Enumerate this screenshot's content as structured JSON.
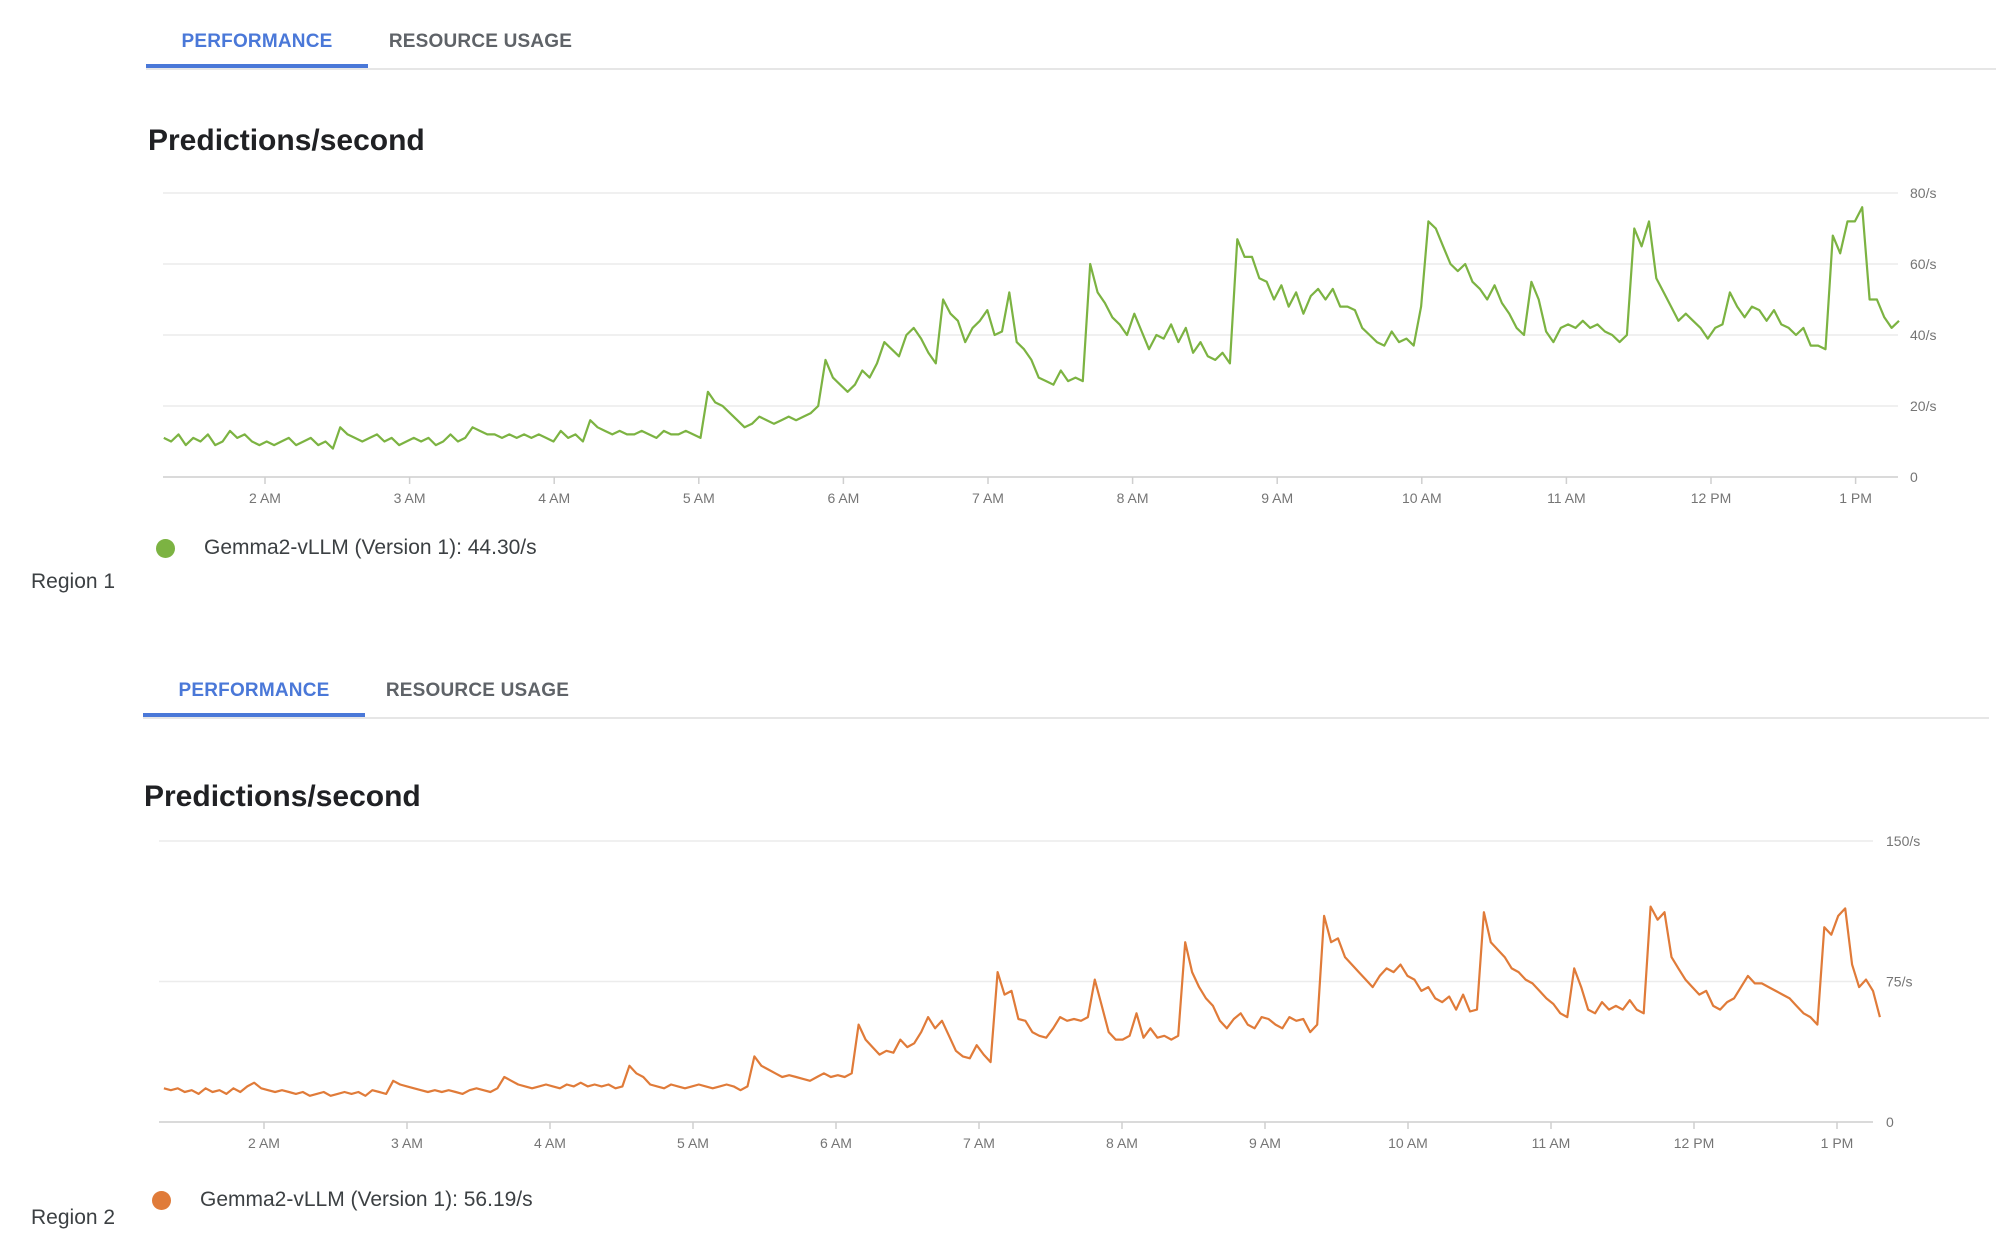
{
  "panels": [
    {
      "region_label": "Region 1",
      "tabs": [
        {
          "label": "PERFORMANCE",
          "active": true
        },
        {
          "label": "RESOURCE USAGE",
          "active": false
        }
      ],
      "title": "Predictions/second",
      "legend": {
        "text": "Gemma2-vLLM (Version 1): 44.30/s",
        "color": "#7cb342"
      }
    },
    {
      "region_label": "Region 2",
      "tabs": [
        {
          "label": "PERFORMANCE",
          "active": true
        },
        {
          "label": "RESOURCE USAGE",
          "active": false
        }
      ],
      "title": "Predictions/second",
      "legend": {
        "text": "Gemma2-vLLM (Version 1): 56.19/s",
        "color": "#e07b39"
      }
    }
  ],
  "chart_data": [
    {
      "type": "line",
      "title": "Predictions/second",
      "region": "Region 1",
      "xlabel": "",
      "ylabel": "",
      "x_ticks": [
        "2 AM",
        "3 AM",
        "4 AM",
        "5 AM",
        "6 AM",
        "7 AM",
        "8 AM",
        "9 AM",
        "10 AM",
        "11 AM",
        "12 PM",
        "1 PM"
      ],
      "y_ticks": [
        "0",
        "20/s",
        "40/s",
        "60/s",
        "80/s"
      ],
      "y_tick_values": [
        0,
        20,
        40,
        60,
        80
      ],
      "ylim": [
        0,
        80
      ],
      "x_start_hour": 1.3,
      "x_end_hour": 13.3,
      "grid": true,
      "legend_position": "bottom-left",
      "series": [
        {
          "name": "Gemma2-vLLM (Version 1)",
          "color": "#7cb342",
          "values": [
            11,
            10,
            12,
            9,
            11,
            10,
            12,
            9,
            10,
            13,
            11,
            12,
            10,
            9,
            10,
            9,
            10,
            11,
            9,
            10,
            11,
            9,
            10,
            8,
            14,
            12,
            11,
            10,
            11,
            12,
            10,
            11,
            9,
            10,
            11,
            10,
            11,
            9,
            10,
            12,
            10,
            11,
            14,
            13,
            12,
            12,
            11,
            12,
            11,
            12,
            11,
            12,
            11,
            10,
            13,
            11,
            12,
            10,
            16,
            14,
            13,
            12,
            13,
            12,
            12,
            13,
            12,
            11,
            13,
            12,
            12,
            13,
            12,
            11,
            24,
            21,
            20,
            18,
            16,
            14,
            15,
            17,
            16,
            15,
            16,
            17,
            16,
            17,
            18,
            20,
            33,
            28,
            26,
            24,
            26,
            30,
            28,
            32,
            38,
            36,
            34,
            40,
            42,
            39,
            35,
            32,
            50,
            46,
            44,
            38,
            42,
            44,
            47,
            40,
            41,
            52,
            38,
            36,
            33,
            28,
            27,
            26,
            30,
            27,
            28,
            27,
            60,
            52,
            49,
            45,
            43,
            40,
            46,
            41,
            36,
            40,
            39,
            43,
            38,
            42,
            35,
            38,
            34,
            33,
            35,
            32,
            67,
            62,
            62,
            56,
            55,
            50,
            54,
            48,
            52,
            46,
            51,
            53,
            50,
            53,
            48,
            48,
            47,
            42,
            40,
            38,
            37,
            41,
            38,
            39,
            37,
            48,
            72,
            70,
            65,
            60,
            58,
            60,
            55,
            53,
            50,
            54,
            49,
            46,
            42,
            40,
            55,
            50,
            41,
            38,
            42,
            43,
            42,
            44,
            42,
            43,
            41,
            40,
            38,
            40,
            70,
            65,
            72,
            56,
            52,
            48,
            44,
            46,
            44,
            42,
            39,
            42,
            43,
            52,
            48,
            45,
            48,
            47,
            44,
            47,
            43,
            42,
            40,
            42,
            37,
            37,
            36,
            68,
            63,
            72,
            72,
            76,
            50,
            50,
            45,
            42,
            44
          ]
        }
      ]
    },
    {
      "type": "line",
      "title": "Predictions/second",
      "region": "Region 2",
      "xlabel": "",
      "ylabel": "",
      "x_ticks": [
        "2 AM",
        "3 AM",
        "4 AM",
        "5 AM",
        "6 AM",
        "7 AM",
        "8 AM",
        "9 AM",
        "10 AM",
        "11 AM",
        "12 PM",
        "1 PM"
      ],
      "y_ticks": [
        "0",
        "75/s",
        "150/s"
      ],
      "y_tick_values": [
        0,
        75,
        150
      ],
      "ylim": [
        0,
        150
      ],
      "x_start_hour": 1.3,
      "x_end_hour": 13.3,
      "grid": true,
      "legend_position": "bottom-left",
      "series": [
        {
          "name": "Gemma2-vLLM (Version 1)",
          "color": "#e07b39",
          "values": [
            18,
            17,
            18,
            16,
            17,
            15,
            18,
            16,
            17,
            15,
            18,
            16,
            19,
            21,
            18,
            17,
            16,
            17,
            16,
            15,
            16,
            14,
            15,
            16,
            14,
            15,
            16,
            15,
            16,
            14,
            17,
            16,
            15,
            22,
            20,
            19,
            18,
            17,
            16,
            17,
            16,
            17,
            16,
            15,
            17,
            18,
            17,
            16,
            18,
            24,
            22,
            20,
            19,
            18,
            19,
            20,
            19,
            18,
            20,
            19,
            21,
            19,
            20,
            19,
            20,
            18,
            19,
            30,
            26,
            24,
            20,
            19,
            18,
            20,
            19,
            18,
            19,
            20,
            19,
            18,
            19,
            20,
            19,
            17,
            19,
            35,
            30,
            28,
            26,
            24,
            25,
            24,
            23,
            22,
            24,
            26,
            24,
            25,
            24,
            26,
            52,
            44,
            40,
            36,
            38,
            37,
            44,
            40,
            42,
            48,
            56,
            50,
            54,
            46,
            38,
            35,
            34,
            41,
            36,
            32,
            80,
            68,
            70,
            55,
            54,
            48,
            46,
            45,
            50,
            56,
            54,
            55,
            54,
            56,
            76,
            62,
            48,
            44,
            44,
            46,
            58,
            45,
            50,
            45,
            46,
            44,
            46,
            96,
            80,
            72,
            66,
            62,
            54,
            50,
            55,
            58,
            52,
            50,
            56,
            55,
            52,
            50,
            56,
            54,
            55,
            48,
            52,
            110,
            96,
            98,
            88,
            84,
            80,
            76,
            72,
            78,
            82,
            80,
            84,
            78,
            76,
            70,
            72,
            66,
            64,
            67,
            60,
            68,
            59,
            60,
            112,
            96,
            92,
            88,
            82,
            80,
            76,
            74,
            70,
            66,
            63,
            58,
            56,
            82,
            72,
            60,
            58,
            64,
            60,
            62,
            60,
            65,
            60,
            58,
            115,
            108,
            112,
            88,
            82,
            76,
            72,
            68,
            70,
            62,
            60,
            64,
            66,
            72,
            78,
            74,
            74,
            72,
            70,
            68,
            66,
            62,
            58,
            56,
            52,
            104,
            100,
            110,
            114,
            84,
            72,
            76,
            70,
            56
          ]
        }
      ]
    }
  ]
}
